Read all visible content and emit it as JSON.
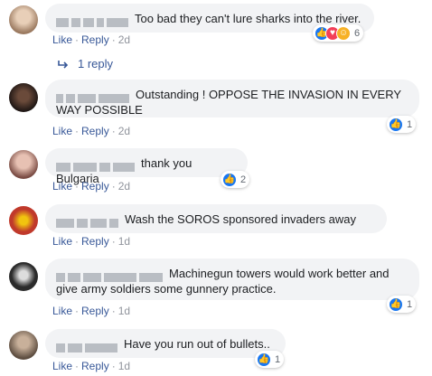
{
  "comments": [
    {
      "text": "Too bad they can't lure sharks into the river.",
      "time": "2d",
      "reaction_count": "6",
      "reactions": [
        "like",
        "love",
        "haha"
      ],
      "avatar_color": "#c9a98d"
    },
    {
      "text": "Outstanding ! OPPOSE THE INVASION IN EVERY WAY POSSIBLE",
      "time": "2d",
      "reaction_count": "1",
      "reactions": [
        "like"
      ],
      "avatar_color": "#3a2c28"
    },
    {
      "text": "thank you Bulgaria",
      "time": "2d",
      "reaction_count": "2",
      "reactions": [
        "like"
      ],
      "avatar_color": "#b37a70"
    },
    {
      "text": "Wash the SOROS sponsored invaders away",
      "time": "1d",
      "reaction_count": "",
      "reactions": [],
      "avatar_color": "#c0392b"
    },
    {
      "text": "Machinegun towers would work better and give army soldiers some gunnery practice.",
      "time": "1d",
      "reaction_count": "1",
      "reactions": [
        "like"
      ],
      "avatar_color": "#2b2b2b"
    },
    {
      "text": "Have you run out of bullets..",
      "time": "1d",
      "reaction_count": "1",
      "reactions": [
        "like"
      ],
      "avatar_color": "#8c7b6a"
    }
  ],
  "labels": {
    "like": "Like",
    "reply": "Reply",
    "separator": "·"
  },
  "replies": {
    "label": "1 reply"
  },
  "colors": {
    "link": "#385898",
    "bubble": "#f2f3f5",
    "like_blue": "#1877f2"
  }
}
